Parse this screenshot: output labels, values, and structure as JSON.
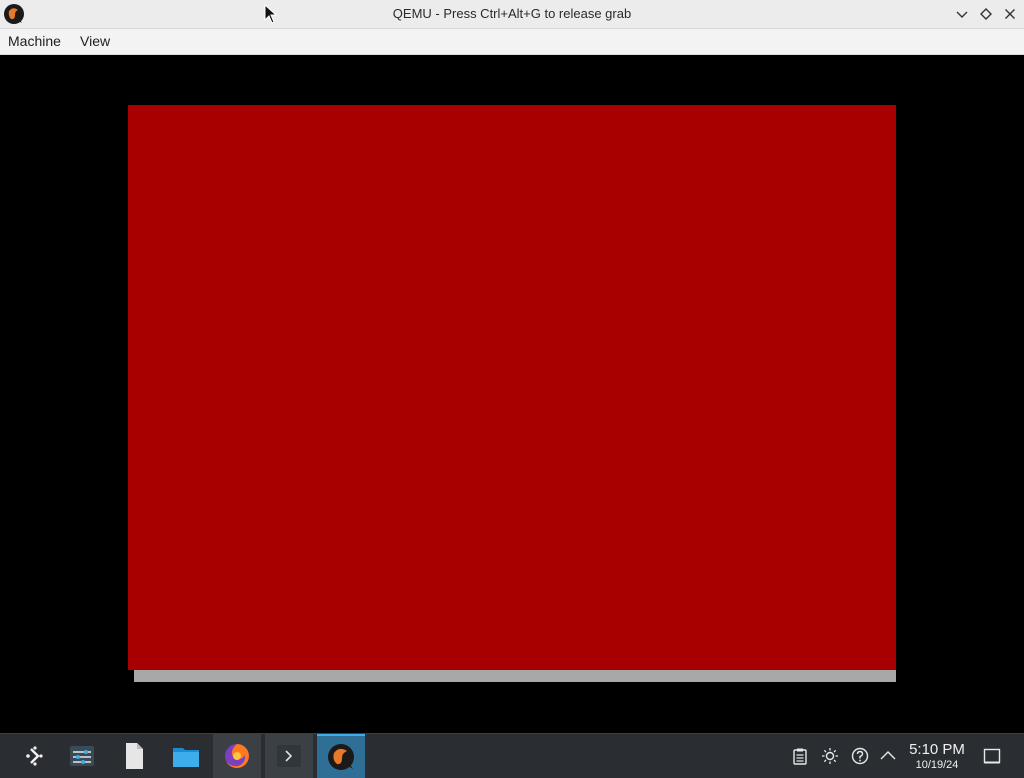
{
  "window": {
    "title": "QEMU - Press Ctrl+Alt+G to release grab",
    "app_icon": "qemu-icon",
    "controls": [
      "chevron-down-icon",
      "diamond-icon",
      "close-icon"
    ]
  },
  "menu": {
    "items": [
      {
        "label": "Machine"
      },
      {
        "label": "View"
      }
    ]
  },
  "guest": {
    "main_color": "#a80000",
    "bar_color": "#a8a8a8"
  },
  "taskbar": {
    "launchers": [
      "application-launcher-icon",
      "system-settings-icon",
      "text-file-icon",
      "folder-icon",
      "firefox-icon",
      "terminal-icon",
      "qemu-icon"
    ],
    "tray": [
      "clipboard-icon",
      "brightness-icon",
      "network-icon",
      "chevron-up-icon"
    ],
    "clock": {
      "time": "5:10 PM",
      "date": "10/19/24"
    },
    "show_desktop_icon": "show-desktop-icon"
  },
  "colors": {
    "titlebar": "#ececec",
    "taskbar": "#2a2e32",
    "accent": "#3daee9"
  }
}
